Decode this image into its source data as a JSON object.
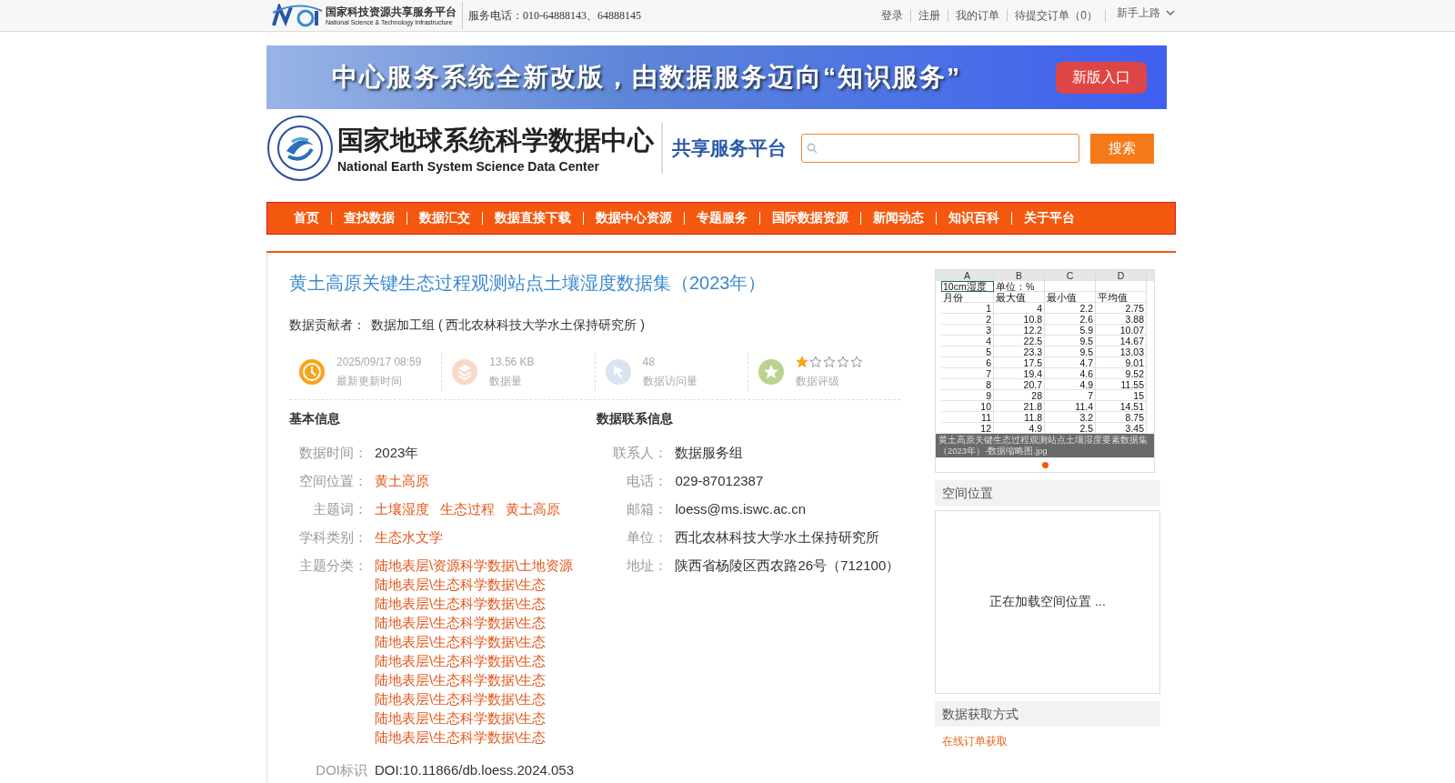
{
  "top_bar": {
    "logo_title": "国家科技资源共享服务平台",
    "logo_subtitle": "National Science & Technology Infrastructure",
    "phone": "服务电话：010-64888143、64888145",
    "links": [
      "登录",
      "注册",
      "我的订单",
      "待提交订单（0）"
    ],
    "guide": "新手上路"
  },
  "banner": {
    "text": "中心服务系统全新改版，由数据服务迈向“知识服务”",
    "button": "新版入口"
  },
  "header": {
    "title_cn": "国家地球系统科学数据中心",
    "title_en": "National Earth System Science Data Center",
    "platform": "共享服务平台",
    "search_button": "搜索"
  },
  "nav": [
    "首页",
    "查找数据",
    "数据汇交",
    "数据直接下载",
    "数据中心资源",
    "专题服务",
    "国际数据资源",
    "新闻动态",
    "知识百科",
    "关于平台"
  ],
  "dataset": {
    "title": "黄土高原关键生态过程观测站点土壤湿度数据集（2023年）",
    "contributor_label": "数据贡献者：",
    "contributor": "数据加工组 ( 西北农林科技大学水土保持研究所 )"
  },
  "stats": [
    {
      "kind": "time",
      "value": "2025/09/17 08:59",
      "label": "最新更新时间"
    },
    {
      "kind": "size",
      "value": "13.56 KB",
      "label": "数据量"
    },
    {
      "kind": "visits",
      "value": "48",
      "label": "数据访问量"
    },
    {
      "kind": "rating",
      "stars": 1,
      "label": "数据评级"
    }
  ],
  "basic_info": {
    "heading": "基本信息",
    "fields": [
      {
        "label": "数据时间：",
        "kind": "text",
        "values": [
          "2023年"
        ]
      },
      {
        "label": "空间位置：",
        "kind": "link",
        "values": [
          "黄土高原"
        ]
      },
      {
        "label": "主题词：",
        "kind": "link",
        "values": [
          "土壤湿度",
          "生态过程",
          "黄土高原"
        ]
      },
      {
        "label": "学科类别：",
        "kind": "link",
        "values": [
          "生态水文学"
        ]
      },
      {
        "label": "主题分类：",
        "kind": "list",
        "values": [
          "陆地表层\\资源科学数据\\土地资源",
          "陆地表层\\生态科学数据\\生态",
          "陆地表层\\生态科学数据\\生态",
          "陆地表层\\生态科学数据\\生态",
          "陆地表层\\生态科学数据\\生态",
          "陆地表层\\生态科学数据\\生态",
          "陆地表层\\生态科学数据\\生态",
          "陆地表层\\生态科学数据\\生态",
          "陆地表层\\生态科学数据\\生态",
          "陆地表层\\生态科学数据\\生态"
        ]
      },
      {
        "label": "DOI标识",
        "kind": "text",
        "values": [
          "DOI:10.11866/db.loess.2024.053"
        ]
      }
    ]
  },
  "contact": {
    "heading": "数据联系信息",
    "fields": [
      {
        "label": "联系人：",
        "value": "数据服务组"
      },
      {
        "label": "电话：",
        "value": "029-87012387"
      },
      {
        "label": "邮箱：",
        "value": "loess@ms.iswc.ac.cn"
      },
      {
        "label": "单位：",
        "value": "西北农林科技大学水土保持研究所"
      },
      {
        "label": "地址：",
        "value": "陕西省杨陵区西农路26号（712100）"
      }
    ]
  },
  "thumbnail": {
    "columns": [
      "A",
      "B",
      "C",
      "D"
    ],
    "rows": [
      [
        "10cm湿度",
        "单位：%",
        "",
        ""
      ],
      [
        "月份",
        "最大值",
        "最小值",
        "平均值"
      ],
      [
        "1",
        "4",
        "2.2",
        "2.75"
      ],
      [
        "2",
        "10.8",
        "2.6",
        "3.88"
      ],
      [
        "3",
        "12.2",
        "5.9",
        "10.07"
      ],
      [
        "4",
        "22.5",
        "9.5",
        "14.67"
      ],
      [
        "5",
        "23.3",
        "9.5",
        "13.03"
      ],
      [
        "6",
        "17.5",
        "4.7",
        "9.01"
      ],
      [
        "7",
        "19.4",
        "4.6",
        "9.52"
      ],
      [
        "8",
        "20.7",
        "4.9",
        "11.55"
      ],
      [
        "9",
        "28",
        "7",
        "15"
      ],
      [
        "10",
        "21.8",
        "11.4",
        "14.51"
      ],
      [
        "11",
        "11.8",
        "3.2",
        "8.75"
      ],
      [
        "12",
        "4.9",
        "2.5",
        "3.45"
      ]
    ],
    "caption": "黄土高原关键生态过程观测站点土壤湿度要素数据集（2023年）-数据缩略图.jpg",
    "slides": [
      {
        "selected": true
      }
    ]
  },
  "spatial": {
    "heading": "空间位置",
    "loading": "正在加载空间位置 ..."
  },
  "access": {
    "heading": "数据获取方式",
    "link": "在线订单获取"
  }
}
